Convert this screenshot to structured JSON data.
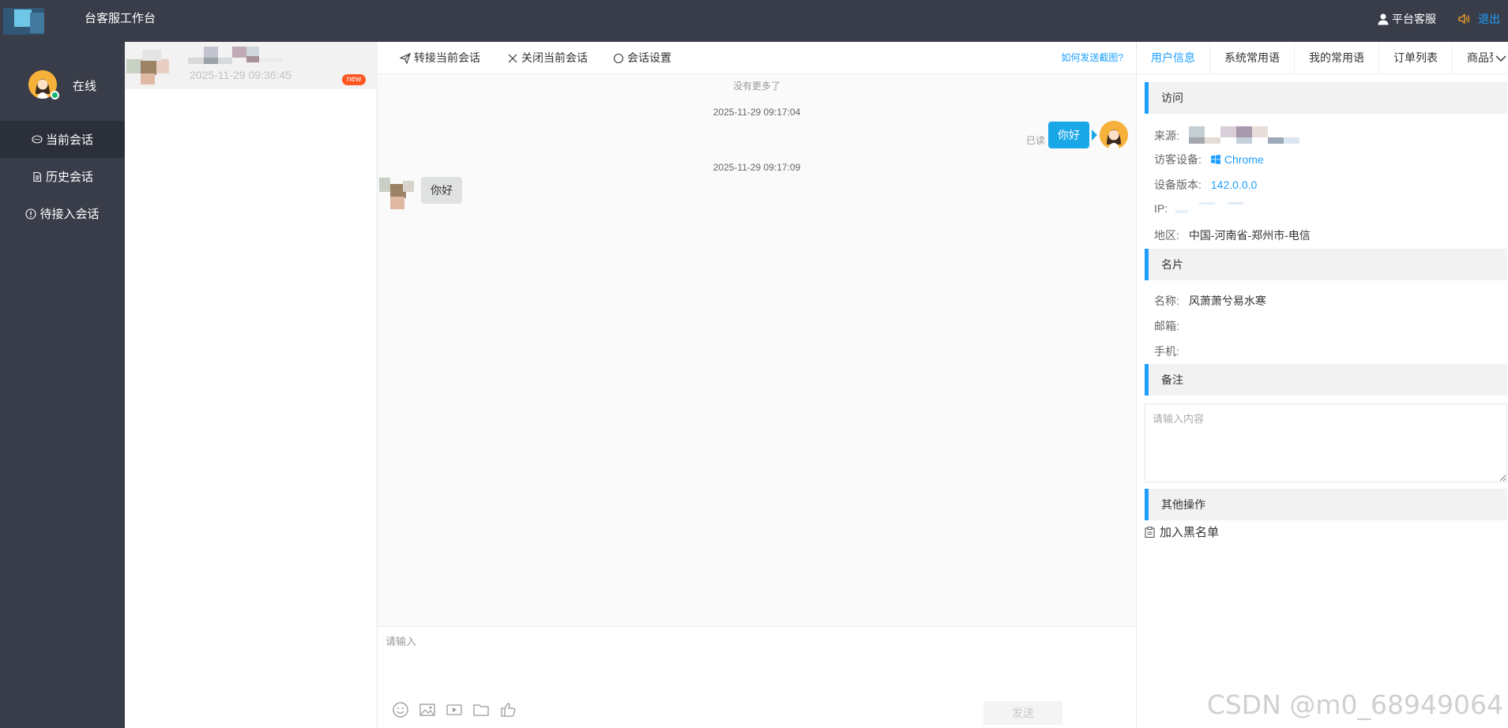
{
  "header": {
    "title": "台客服工作台",
    "user_name": "平台客服",
    "logout_label": "退出"
  },
  "sidebar": {
    "status": "在线",
    "items": [
      {
        "label": "当前会话",
        "icon": "chat-icon",
        "active": true
      },
      {
        "label": "历史会话",
        "icon": "document-icon",
        "active": false
      },
      {
        "label": "待接入会话",
        "icon": "info-icon",
        "active": false
      }
    ]
  },
  "session_list": {
    "items": [
      {
        "time": "2025-11-29 09:36:45",
        "badge": "new"
      }
    ]
  },
  "chat": {
    "toolbar": {
      "transfer_label": "转接当前会话",
      "close_label": "关闭当前会话",
      "settings_label": "会话设置",
      "help_link": "如何发送截图?"
    },
    "no_more": "没有更多了",
    "messages": [
      {
        "time": "2025-11-29 09:17:04",
        "direction": "out",
        "text": "你好",
        "status": "已读"
      },
      {
        "time": "2025-11-29 09:17:09",
        "direction": "in",
        "text": "你好"
      }
    ],
    "input_placeholder": "请输入",
    "send_label": "发送",
    "input_tools": [
      "emoji-icon",
      "image-icon",
      "video-icon",
      "folder-icon",
      "thumbs-up-icon"
    ]
  },
  "right_panel": {
    "tabs": [
      "用户信息",
      "系统常用语",
      "我的常用语",
      "订单列表",
      "商品列"
    ],
    "visit": {
      "heading": "访问",
      "source_label": "来源:",
      "device_label": "访客设备:",
      "device_value": "Chrome",
      "version_label": "设备版本:",
      "version_value": "142.0.0.0",
      "ip_label": "IP:",
      "region_label": "地区:",
      "region_value": "中国-河南省-郑州市-电信"
    },
    "card": {
      "heading": "名片",
      "name_label": "名称:",
      "name_value": "风萧萧兮易水寒",
      "email_label": "邮箱:",
      "phone_label": "手机:"
    },
    "remark": {
      "heading": "备注",
      "placeholder": "请输入内容"
    },
    "other": {
      "heading": "其他操作",
      "blacklist_label": "加入黑名单"
    }
  },
  "watermark": "CSDN @m0_68949064",
  "colors": {
    "topbar": "#393d49",
    "accent": "#1e9fff",
    "bubble_out": "#1aa7e8",
    "badge": "#ff5722",
    "online": "#16b777"
  }
}
